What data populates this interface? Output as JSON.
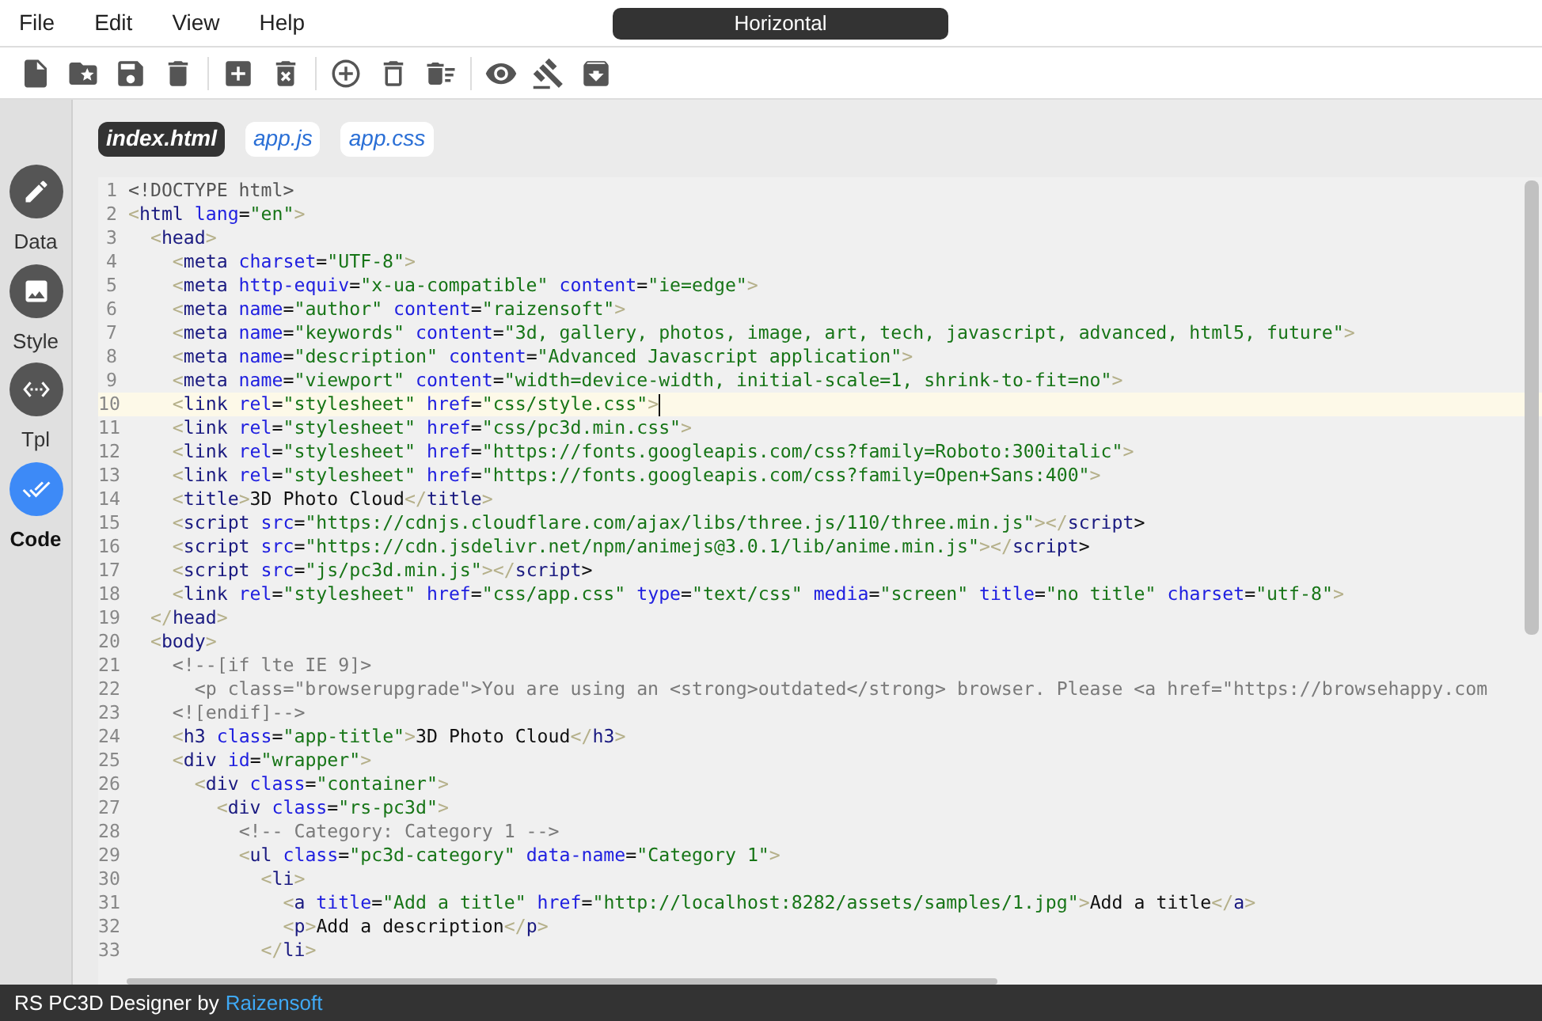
{
  "menu": [
    "File",
    "Edit",
    "View",
    "Help"
  ],
  "layout_title": "Horizontal",
  "sidebar": [
    {
      "label": "Data",
      "selected": false
    },
    {
      "label": "Style",
      "selected": false
    },
    {
      "label": "Tpl",
      "selected": false
    },
    {
      "label": "Code",
      "selected": true
    }
  ],
  "tabs": [
    {
      "label": "index.html",
      "selected": true
    },
    {
      "label": "app.js",
      "selected": false
    },
    {
      "label": "app.css",
      "selected": false
    }
  ],
  "lines": [
    {
      "n": "1",
      "active": false,
      "code": "<!DOCTYPE html>"
    },
    {
      "n": "2",
      "active": false,
      "code": "<html lang=\"en\">"
    },
    {
      "n": "3",
      "active": false,
      "code": "  <head>"
    },
    {
      "n": "4",
      "active": false,
      "code": "    <meta charset=\"UTF-8\">"
    },
    {
      "n": "5",
      "active": false,
      "code": "    <meta http-equiv=\"x-ua-compatible\" content=\"ie=edge\">"
    },
    {
      "n": "6",
      "active": false,
      "code": "    <meta name=\"author\" content=\"raizensoft\">"
    },
    {
      "n": "7",
      "active": false,
      "code": "    <meta name=\"keywords\" content=\"3d, gallery, photos, image, art, tech, javascript, advanced, html5, future\">"
    },
    {
      "n": "8",
      "active": false,
      "code": "    <meta name=\"description\" content=\"Advanced Javascript application\">"
    },
    {
      "n": "9",
      "active": false,
      "code": "    <meta name=\"viewport\" content=\"width=device-width, initial-scale=1, shrink-to-fit=no\">"
    },
    {
      "n": "10",
      "active": true,
      "code": "    <link rel=\"stylesheet\" href=\"css/style.css\">"
    },
    {
      "n": "11",
      "active": false,
      "code": "    <link rel=\"stylesheet\" href=\"css/pc3d.min.css\">"
    },
    {
      "n": "12",
      "active": false,
      "code": "    <link rel=\"stylesheet\" href=\"https://fonts.googleapis.com/css?family=Roboto:300italic\">"
    },
    {
      "n": "13",
      "active": false,
      "code": "    <link rel=\"stylesheet\" href=\"https://fonts.googleapis.com/css?family=Open+Sans:400\">"
    },
    {
      "n": "14",
      "active": false,
      "code": "    <title>3D Photo Cloud</title>"
    },
    {
      "n": "15",
      "active": false,
      "code": "    <script src=\"https://cdnjs.cloudflare.com/ajax/libs/three.js/110/three.min.js\"></script>"
    },
    {
      "n": "16",
      "active": false,
      "code": "    <script src=\"https://cdn.jsdelivr.net/npm/animejs@3.0.1/lib/anime.min.js\"></script>"
    },
    {
      "n": "17",
      "active": false,
      "code": "    <script src=\"js/pc3d.min.js\"></script>"
    },
    {
      "n": "18",
      "active": false,
      "code": "    <link rel=\"stylesheet\" href=\"css/app.css\" type=\"text/css\" media=\"screen\" title=\"no title\" charset=\"utf-8\">"
    },
    {
      "n": "19",
      "active": false,
      "code": "  </head>"
    },
    {
      "n": "20",
      "active": false,
      "code": "  <body>"
    },
    {
      "n": "21",
      "active": false,
      "code": "    <!--[if lte IE 9]>"
    },
    {
      "n": "22",
      "active": false,
      "code": "      <p class=\"browserupgrade\">You are using an <strong>outdated</strong> browser. Please <a href=\"https://browsehappy.com"
    },
    {
      "n": "23",
      "active": false,
      "code": "    <![endif]-->"
    },
    {
      "n": "24",
      "active": false,
      "code": "    <h3 class=\"app-title\">3D Photo Cloud</h3>"
    },
    {
      "n": "25",
      "active": false,
      "code": "    <div id=\"wrapper\">"
    },
    {
      "n": "26",
      "active": false,
      "code": "      <div class=\"container\">"
    },
    {
      "n": "27",
      "active": false,
      "code": "        <div class=\"rs-pc3d\">"
    },
    {
      "n": "28",
      "active": false,
      "code": "          <!-- Category: Category 1 -->"
    },
    {
      "n": "29",
      "active": false,
      "code": "          <ul class=\"pc3d-category\" data-name=\"Category 1\">"
    },
    {
      "n": "30",
      "active": false,
      "code": "            <li>"
    },
    {
      "n": "31",
      "active": false,
      "code": "              <a title=\"Add a title\" href=\"http://localhost:8282/assets/samples/1.jpg\">Add a title</a>"
    },
    {
      "n": "32",
      "active": false,
      "code": "              <p>Add a description</p>"
    },
    {
      "n": "33",
      "active": false,
      "code": "            </li>"
    }
  ],
  "status_bar": {
    "text": "RS PC3D Designer by",
    "link": "Raizensoft"
  }
}
